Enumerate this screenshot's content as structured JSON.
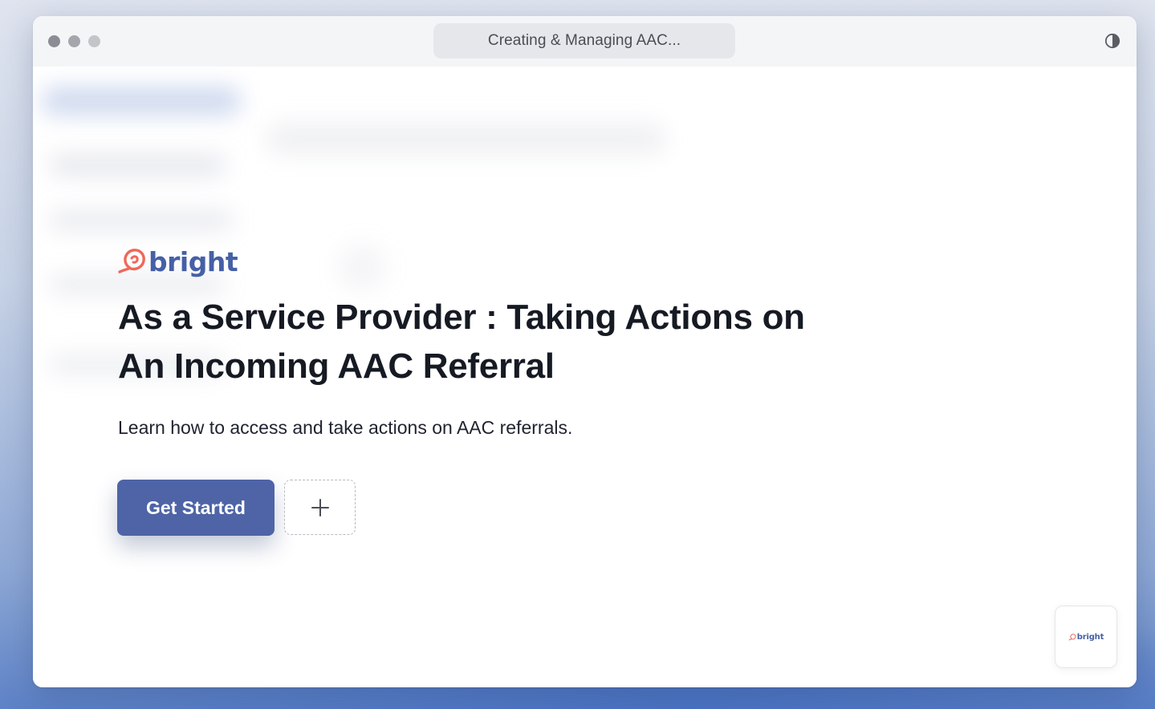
{
  "window": {
    "tab_title": "Creating & Managing AAC...",
    "theme_toggle_icon": "contrast-icon"
  },
  "brand": {
    "name": "bright",
    "logo_icon": "bright-logo-mark-icon",
    "mark_color": "#f0685a",
    "text_color": "#4660a6"
  },
  "hero": {
    "title": "As a Service Provider : Taking Actions on An Incoming AAC Referral",
    "subtitle": "Learn how to access and take actions on AAC referrals."
  },
  "actions": {
    "primary_label": "Get Started",
    "primary_color": "#4e64a6",
    "add_icon": "plus-icon"
  },
  "widget": {
    "label": "bright",
    "icon": "bright-logo-mark-icon"
  }
}
